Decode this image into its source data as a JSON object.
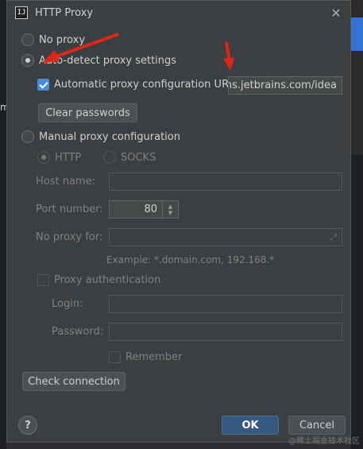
{
  "window": {
    "title": "HTTP Proxy",
    "logo": "IJ"
  },
  "proxy_mode": {
    "no_proxy": "No proxy",
    "auto_detect": "Auto-detect proxy settings",
    "manual": "Manual proxy configuration",
    "selected": "auto_detect"
  },
  "auto": {
    "pac_label": "Automatic proxy configuration URL:",
    "pac_checked": true,
    "pac_url": "gins.jetbrains.com/idea",
    "clear_passwords": "Clear passwords"
  },
  "manual": {
    "http": "HTTP",
    "socks": "SOCKS",
    "host_label": "Host name:",
    "port_label": "Port number:",
    "port_value": "80",
    "no_proxy_label": "No proxy for:",
    "example": "Example: *.domain.com, 192.168.*",
    "proxy_auth": "Proxy authentication",
    "login_label": "Login:",
    "password_label": "Password:",
    "remember": "Remember"
  },
  "buttons": {
    "check_connection": "Check connection",
    "ok": "OK",
    "cancel": "Cancel",
    "help": "?"
  },
  "annotation_color": "#e0261b",
  "watermark": "@稀土掘金技术社区"
}
